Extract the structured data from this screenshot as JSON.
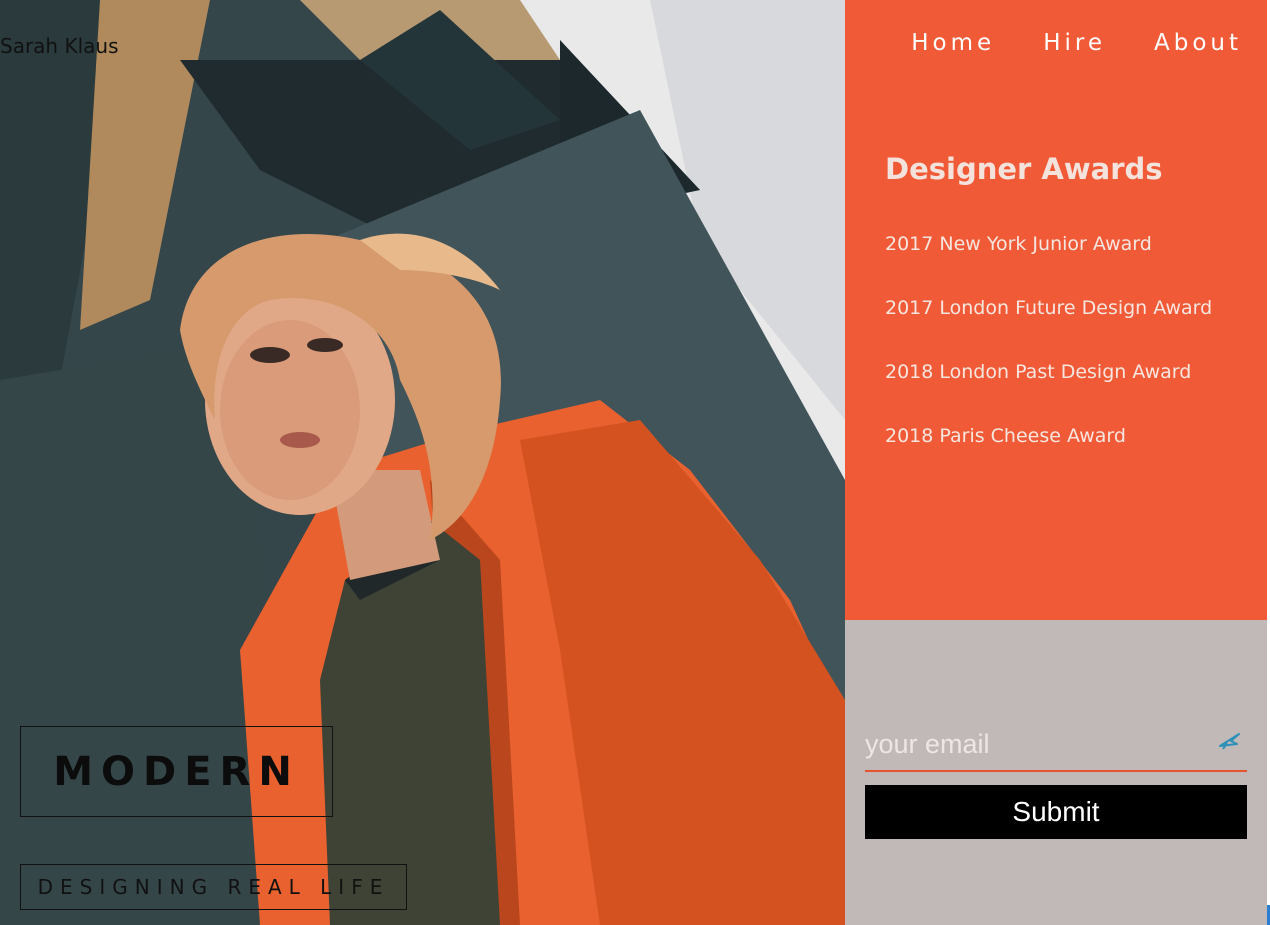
{
  "brand": {
    "name": "Sarah Klaus"
  },
  "nav": {
    "items": [
      "Home",
      "Hire",
      "About"
    ]
  },
  "hero": {
    "title": "MODERN",
    "subtitle": "DESIGNING REAL LIFE"
  },
  "awards": {
    "title": "Designer Awards",
    "items": [
      "2017 New York Junior Award",
      "2017 London Future Design Award",
      "2018 London Past Design Award",
      "2018 Paris Cheese Award"
    ]
  },
  "subscribe": {
    "placeholder": "your email",
    "submit_label": "Submit",
    "icon": "send-icon"
  },
  "colors": {
    "accent": "#f15a37",
    "form_bg": "#c1b9b7",
    "button": "#000000"
  }
}
